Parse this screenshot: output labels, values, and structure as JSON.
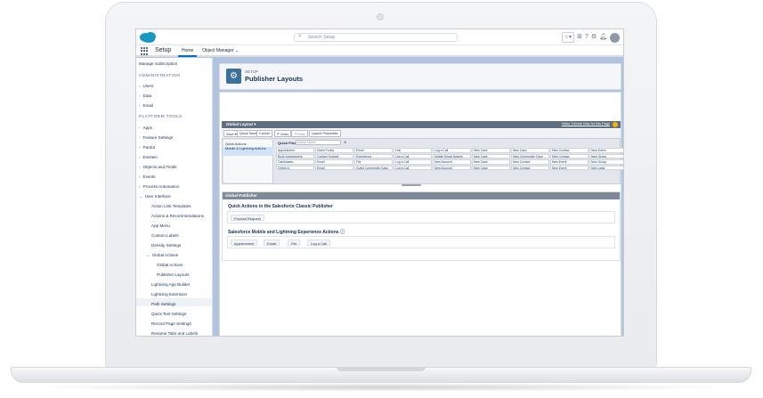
{
  "header": {
    "search_placeholder": "Search Setup",
    "icons": [
      "star-icon",
      "add-icon",
      "help-icon",
      "gear-icon",
      "bell-icon",
      "avatar-icon"
    ]
  },
  "appbar": {
    "app_name": "Setup",
    "tabs": [
      {
        "label": "Home"
      },
      {
        "label": "Object Manager"
      }
    ]
  },
  "sidebar": {
    "items": [
      {
        "label": "Manage Subscription"
      },
      {
        "label": "ADMINISTRATION"
      },
      {
        "label": "Users"
      },
      {
        "label": "Data"
      },
      {
        "label": "Email"
      },
      {
        "label": "PLATFORM TOOLS"
      },
      {
        "label": "Apps"
      },
      {
        "label": "Feature Settings"
      },
      {
        "label": "Pardot"
      },
      {
        "label": "Einstein"
      },
      {
        "label": "Objects and Fields"
      },
      {
        "label": "Events"
      },
      {
        "label": "Process Automation"
      },
      {
        "label": "User Interface"
      },
      {
        "label": "Action Link Templates"
      },
      {
        "label": "Actions & Recommendations"
      },
      {
        "label": "App Menu"
      },
      {
        "label": "Custom Labels"
      },
      {
        "label": "Density Settings"
      },
      {
        "label": "Global Actions"
      },
      {
        "label": "Global Actions"
      },
      {
        "label": "Publisher Layouts"
      },
      {
        "label": "Lightning App Builder"
      },
      {
        "label": "Lightning Extension"
      },
      {
        "label": "Path Settings"
      },
      {
        "label": "Quick Text Settings"
      },
      {
        "label": "Record Page Settings"
      },
      {
        "label": "Rename Tabs and Labels"
      }
    ]
  },
  "page": {
    "setup_label": "SETUP",
    "title": "Publisher Layouts"
  },
  "layout_editor": {
    "layout_name": "Global Layout ▾",
    "links": "Video Tutorial  Help for this Page",
    "toolbar": [
      "Save ▾",
      "Quick Save",
      "Cancel",
      "↶ Undo",
      "↷ Redo",
      "Layout Properties"
    ],
    "palette_categories": [
      "Quick Actions",
      "Mobile & Lightning Actions"
    ],
    "quick_find_label": "Quick Find",
    "quick_find_placeholder": "Action Name",
    "palette_rows": [
      [
        "Appointment",
        "Claim Funds",
        "Email",
        "Link",
        "Log a Call",
        "New Case",
        "New Case",
        "New Contact",
        "New Event"
      ],
      [
        "Book Appointment",
        "Contact Support",
        "Emergency",
        "Log a Call",
        "Mobile Smart Actions",
        "New Case",
        "New Community Case",
        "New Contact",
        "New Group"
      ],
      [
        "Candidates",
        "Email",
        "File",
        "Log a Call",
        "New Account",
        "New Case",
        "New Contact",
        "New Event",
        "New Group"
      ],
      [
        "Check In",
        "Email",
        "Guest Community Case",
        "Log a Call",
        "New Account",
        "New Case",
        "New Contact",
        "New Event",
        "New Lead"
      ]
    ]
  },
  "global_publisher": {
    "title": "Global Publisher",
    "classic_title": "Quick Actions in the Salesforce Classic Publisher",
    "classic_actions": [
      "Product Request"
    ],
    "lightning_title": "Salesforce Mobile and Lightning Experience Actions",
    "lightning_actions": [
      "Appointment",
      "Email",
      "File",
      "Log a Call"
    ]
  }
}
